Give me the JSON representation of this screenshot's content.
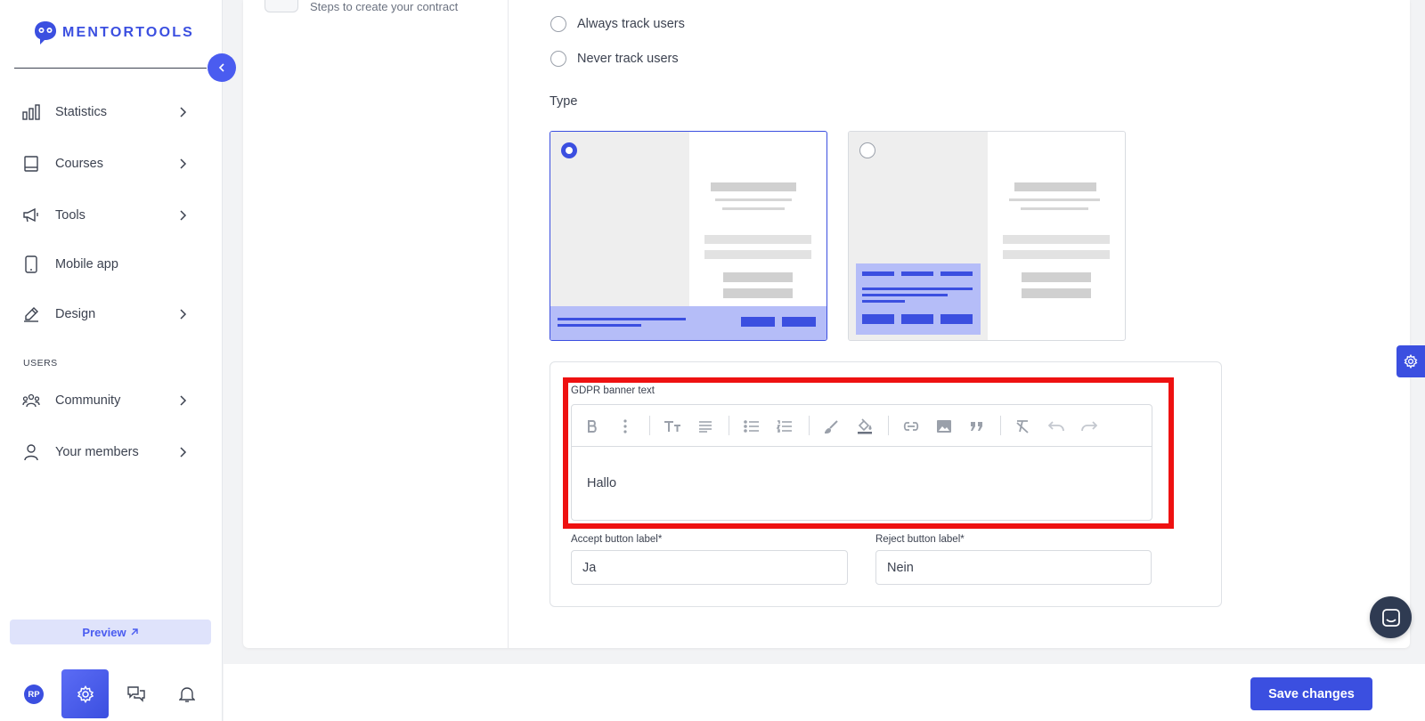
{
  "brand": {
    "name": "MENTORTOOLS"
  },
  "sidebar": {
    "items": [
      {
        "label": "Statistics",
        "icon": "bar-chart-icon"
      },
      {
        "label": "Courses",
        "icon": "book-icon"
      },
      {
        "label": "Tools",
        "icon": "megaphone-icon"
      },
      {
        "label": "Mobile app",
        "icon": "phone-icon"
      },
      {
        "label": "Design",
        "icon": "pencil-icon"
      }
    ],
    "section_users": "USERS",
    "user_items": [
      {
        "label": "Community",
        "icon": "community-icon"
      },
      {
        "label": "Your members",
        "icon": "person-icon"
      }
    ],
    "preview_label": "Preview",
    "avatar_initials": "RP"
  },
  "steps": {
    "text": "Steps to create your contract"
  },
  "tracking": {
    "options": [
      "Always track users",
      "Never track users"
    ]
  },
  "type_section": {
    "label": "Type"
  },
  "gdpr": {
    "label": "GDPR banner text",
    "content": "Hallo"
  },
  "accept": {
    "label": "Accept button label*",
    "value": "Ja"
  },
  "reject": {
    "label": "Reject button label*",
    "value": "Nein"
  },
  "footer": {
    "save_label": "Save changes"
  },
  "colors": {
    "accent": "#3b4fe0",
    "highlight": "#ee1111"
  }
}
